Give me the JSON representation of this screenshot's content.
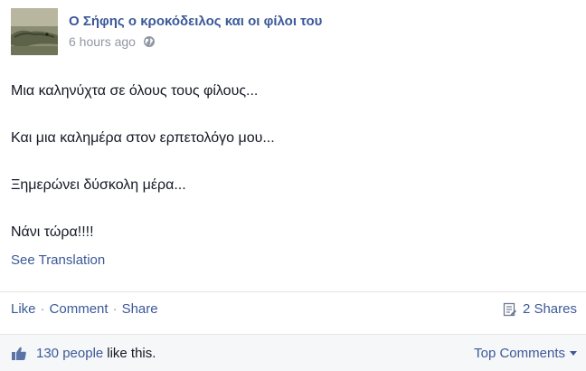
{
  "post": {
    "author": "Ο Σήφης ο κροκόδειλος και οι φίλοι του",
    "timestamp": "6 hours ago",
    "audience_icon": "globe-icon",
    "lines": [
      "Μια καληνύχτα σε όλους τους φίλους...",
      "Και μια καλημέρα στον ερπετολόγο μου...",
      "Ξημερώνει δύσκολη μέρα...",
      "Νάνι τώρα!!!!"
    ],
    "see_translation": "See Translation"
  },
  "actions": {
    "like": "Like",
    "separator": "·",
    "comment": "Comment",
    "share": "Share",
    "shares_count": "2 Shares"
  },
  "footer": {
    "likes_count": "130 people",
    "likes_suffix": "like this.",
    "top_comments": "Top Comments"
  },
  "colors": {
    "link": "#3b5998",
    "text": "#141823",
    "meta": "#9197a3",
    "footer_bg": "#f6f7f9"
  }
}
